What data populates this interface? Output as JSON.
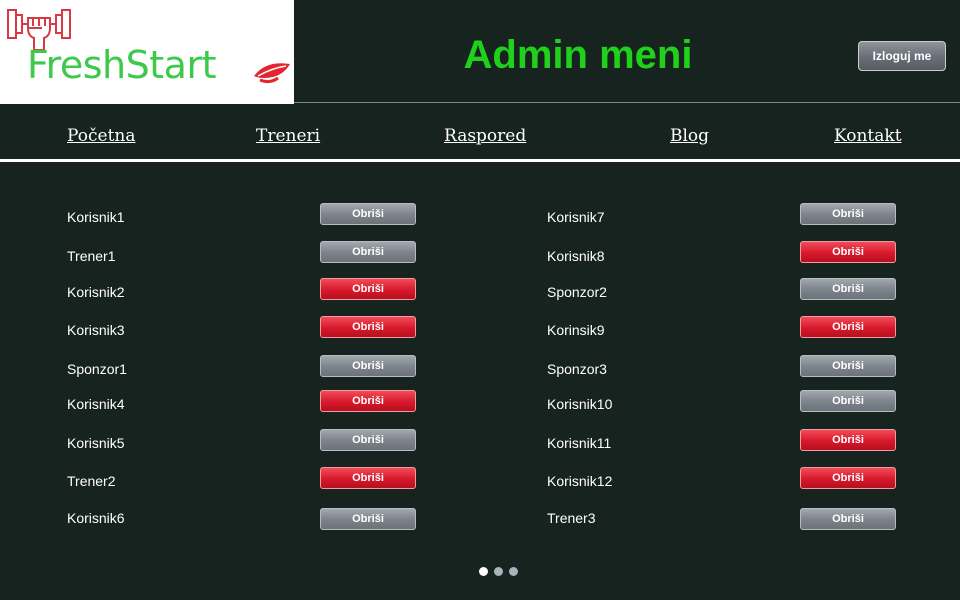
{
  "header": {
    "logo_text": "FreshStart",
    "title": "Admin meni",
    "logout_label": "Izloguj me"
  },
  "nav": {
    "items": [
      "Početna",
      "Treneri",
      "Raspored",
      "Blog",
      "Kontakt"
    ]
  },
  "users": {
    "delete_label": "Obriši",
    "left": [
      {
        "name": "Korisnik1",
        "button": "gray"
      },
      {
        "name": "Trener1",
        "button": "gray"
      },
      {
        "name": "Korisnik2",
        "button": "red"
      },
      {
        "name": "Korisnik3",
        "button": "red"
      },
      {
        "name": "Sponzor1",
        "button": "gray"
      },
      {
        "name": "Korisnik4",
        "button": "red"
      },
      {
        "name": "Korisnik5",
        "button": "gray"
      },
      {
        "name": "Trener2",
        "button": "red"
      },
      {
        "name": "Korisnik6",
        "button": "gray"
      }
    ],
    "right": [
      {
        "name": "Korisnik7",
        "button": "gray"
      },
      {
        "name": "Korisnik8",
        "button": "red"
      },
      {
        "name": "Sponzor2",
        "button": "gray"
      },
      {
        "name": "Korinsik9",
        "button": "red"
      },
      {
        "name": "Sponzor3",
        "button": "gray"
      },
      {
        "name": "Korisnik10",
        "button": "gray"
      },
      {
        "name": "Korisnik11",
        "button": "red"
      },
      {
        "name": "Korisnik12",
        "button": "red"
      },
      {
        "name": "Trener3",
        "button": "gray"
      }
    ]
  },
  "pagination": {
    "pages": 3,
    "active": 1
  },
  "colors": {
    "background": "#17231f",
    "title": "#1fd11a",
    "logo": "#3ec94a",
    "danger": "#d8192c"
  }
}
